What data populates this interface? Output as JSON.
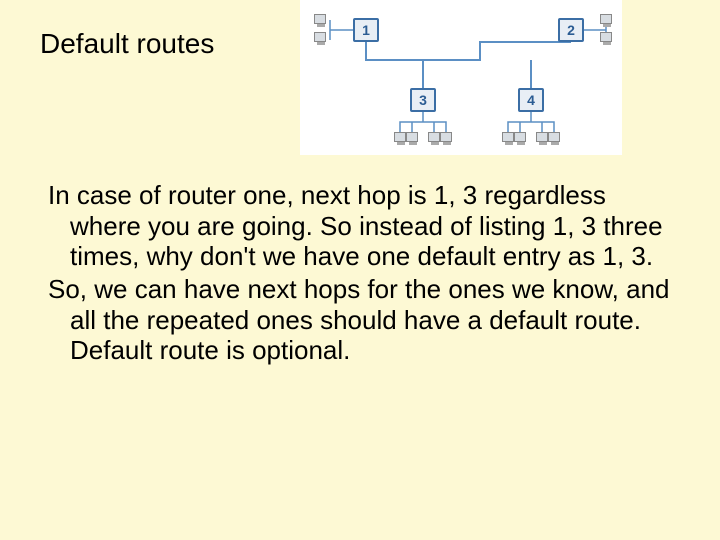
{
  "title": "Default routes",
  "paragraphs": {
    "p1": "In case of router one, next hop is 1, 3 regardless where you are going. So instead of listing 1, 3 three times, why don't we have one default entry as 1, 3.",
    "p2": "So, we can have next hops for the ones we know, and all the repeated ones should have a default route.  Default route is optional."
  },
  "diagram": {
    "routers": {
      "r1": "1",
      "r2": "2",
      "r3": "3",
      "r4": "4"
    }
  }
}
